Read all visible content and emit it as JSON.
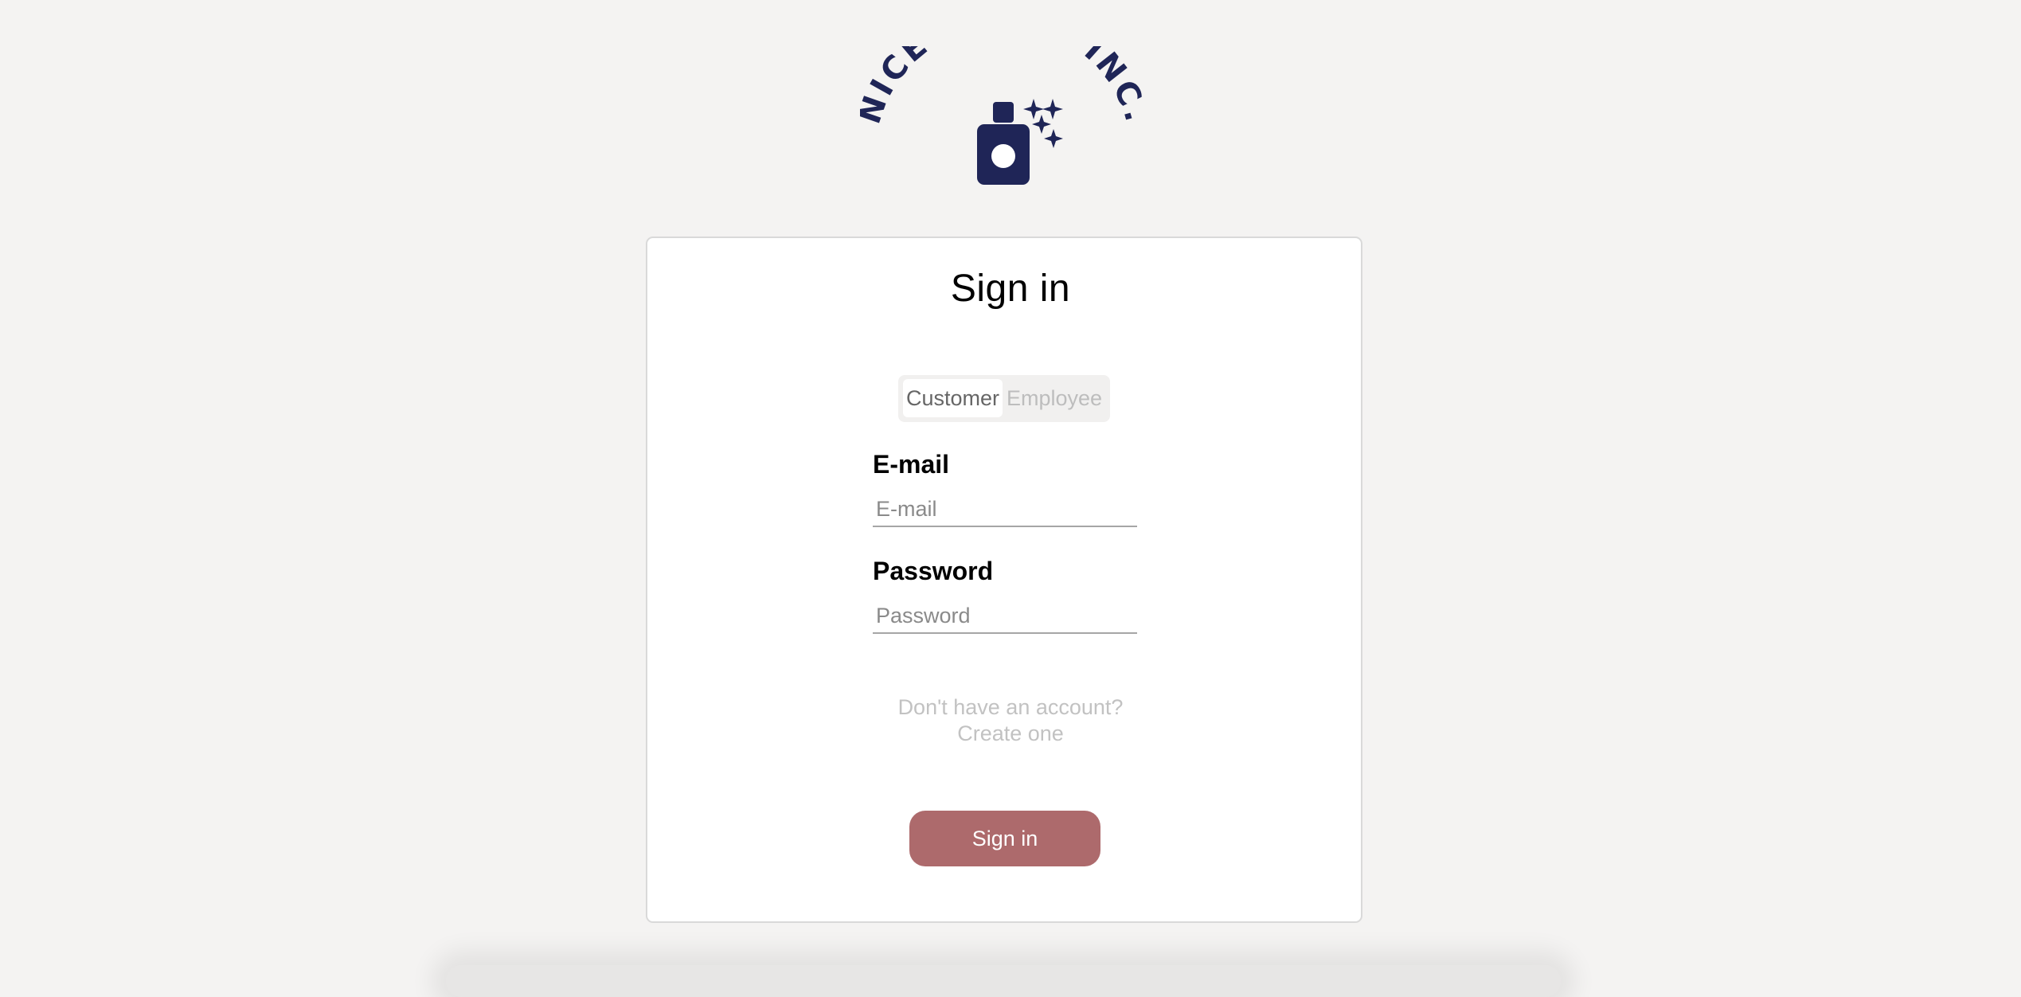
{
  "brand": {
    "logo_text": "NICE CLEAN INC.",
    "color": "#1f2557"
  },
  "card": {
    "title": "Sign in"
  },
  "role_toggle": {
    "options": [
      "Customer",
      "Employee"
    ],
    "selected": "Customer"
  },
  "email": {
    "label": "E-mail",
    "placeholder": "E-mail",
    "value": ""
  },
  "password": {
    "label": "Password",
    "placeholder": "Password",
    "value": ""
  },
  "account_link": {
    "line1": "Don't have an account?",
    "line2": "Create one"
  },
  "submit": {
    "label": "Sign in",
    "color": "#ad6a6c"
  },
  "colors": {
    "background": "#f4f3f2",
    "card": "#ffffff"
  }
}
